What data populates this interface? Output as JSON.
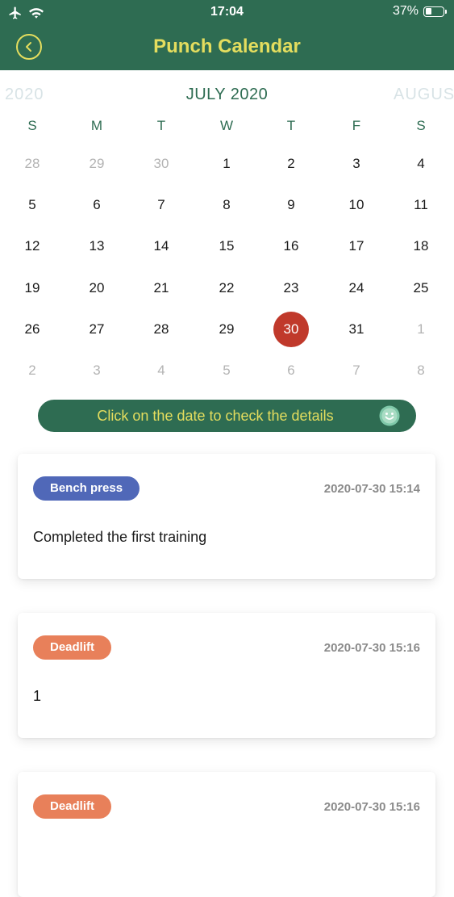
{
  "status_bar": {
    "time": "17:04",
    "battery_text": "37%",
    "battery_level": 0.37,
    "icons": [
      "airplane-icon",
      "wifi-icon",
      "battery-icon"
    ]
  },
  "nav": {
    "title": "Punch Calendar",
    "back_icon": "chevron-left-circle-icon",
    "accent": "#e4dd5e",
    "background": "#2e6c52"
  },
  "calendar": {
    "prev_month": "2020",
    "current_month": "JULY 2020",
    "next_month": "AUGUS",
    "weekdays": [
      "S",
      "M",
      "T",
      "W",
      "T",
      "F",
      "S"
    ],
    "weeks": [
      [
        {
          "d": "28",
          "muted": true
        },
        {
          "d": "29",
          "muted": true
        },
        {
          "d": "30",
          "muted": true
        },
        {
          "d": "1"
        },
        {
          "d": "2"
        },
        {
          "d": "3"
        },
        {
          "d": "4"
        }
      ],
      [
        {
          "d": "5"
        },
        {
          "d": "6"
        },
        {
          "d": "7"
        },
        {
          "d": "8"
        },
        {
          "d": "9"
        },
        {
          "d": "10"
        },
        {
          "d": "11"
        }
      ],
      [
        {
          "d": "12"
        },
        {
          "d": "13"
        },
        {
          "d": "14"
        },
        {
          "d": "15"
        },
        {
          "d": "16"
        },
        {
          "d": "17"
        },
        {
          "d": "18"
        }
      ],
      [
        {
          "d": "19"
        },
        {
          "d": "20"
        },
        {
          "d": "21"
        },
        {
          "d": "22"
        },
        {
          "d": "23"
        },
        {
          "d": "24"
        },
        {
          "d": "25"
        }
      ],
      [
        {
          "d": "26"
        },
        {
          "d": "27"
        },
        {
          "d": "28"
        },
        {
          "d": "29"
        },
        {
          "d": "30",
          "selected": true
        },
        {
          "d": "31"
        },
        {
          "d": "1",
          "muted": true
        }
      ],
      [
        {
          "d": "2",
          "muted": true
        },
        {
          "d": "3",
          "muted": true
        },
        {
          "d": "4",
          "muted": true
        },
        {
          "d": "5",
          "muted": true
        },
        {
          "d": "6",
          "muted": true
        },
        {
          "d": "7",
          "muted": true
        },
        {
          "d": "8",
          "muted": true
        }
      ]
    ],
    "selected_color": "#c0392b"
  },
  "hint": {
    "text": "Click on the date to check the details",
    "icon": "smile-icon"
  },
  "records": [
    {
      "tag": "Bench press",
      "tag_color": "#5068b8",
      "time": "2020-07-30 15:14",
      "text": "Completed the first training"
    },
    {
      "tag": "Deadlift",
      "tag_color": "#e8805a",
      "time": "2020-07-30 15:16",
      "text": "1"
    },
    {
      "tag": "Deadlift",
      "tag_color": "#e8805a",
      "time": "2020-07-30 15:16",
      "text": ""
    }
  ]
}
